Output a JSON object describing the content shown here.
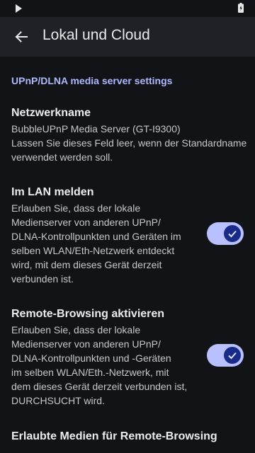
{
  "appbar": {
    "title": "Lokal und Cloud"
  },
  "section": {
    "header": "UPnP/DLNA media server settings"
  },
  "prefs": {
    "netzwerkname": {
      "title": "Netzwerkname",
      "summary": [
        "BubbleUPnP Media Server (GT-I9300)",
        "Lassen Sie dieses Feld leer, wenn der Standardname",
        "verwendet werden soll."
      ]
    },
    "lan": {
      "title": "Im LAN melden",
      "summary": [
        "Erlauben Sie, dass der lokale",
        "Medienserver von anderen UPnP/",
        "DLNA-Kontrollpunkten und Geräten im",
        "selben WLAN/Eth-Netzwerk entdeckt",
        "wird, mit dem dieses Gerät derzeit",
        "verbunden ist."
      ],
      "checked": true
    },
    "remote": {
      "title": "Remote-Browsing aktivieren",
      "summary": [
        "Erlauben Sie, dass der lokale",
        "Medienserver von anderen UPnP/",
        "DLNA-Kontrollpunkten und -Geräten",
        "im selben WLAN/Eth.-Netzwerk, mit",
        "dem dieses Gerät derzeit verbunden ist,",
        "DURCHSUCHT wird."
      ],
      "checked": true
    },
    "media": {
      "title": "Erlaubte Medien für Remote-Browsing"
    }
  },
  "colors": {
    "background": "#121317",
    "appbar": "#1f2126",
    "accent": "#aeb8ff",
    "switch_track": "#b8c0ff",
    "switch_thumb": "#1a2a88"
  },
  "icons": {
    "status_play": "play-icon",
    "status_battery": "battery-charging-icon",
    "back": "arrow-back-icon",
    "check": "check-icon"
  }
}
